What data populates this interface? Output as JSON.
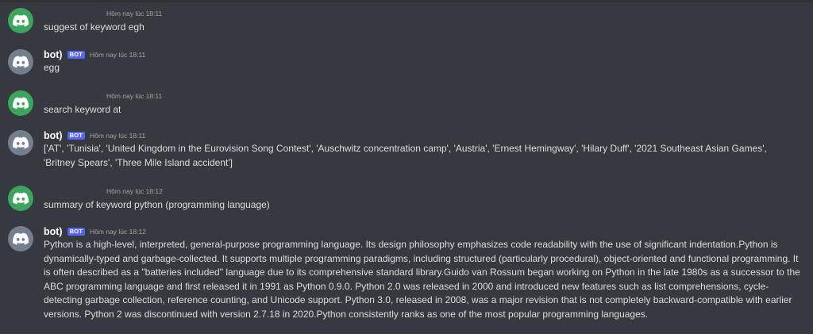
{
  "colors": {
    "background": "#36393f",
    "user_avatar": "#3ba55d",
    "bot_avatar": "#747f8d",
    "bot_badge": "#5865f2",
    "text": "#dcddde",
    "timestamp": "#a3a6aa"
  },
  "icons": {
    "avatar": "discord-logo-icon"
  },
  "messages": [
    {
      "author": "",
      "is_bot": false,
      "timestamp": "Hôm nay lúc 18:11",
      "content": "suggest of keyword egh"
    },
    {
      "author": "bot)",
      "is_bot": true,
      "badge": "BOT",
      "timestamp": "Hôm nay lúc 18:11",
      "content": "egg"
    },
    {
      "author": "",
      "is_bot": false,
      "timestamp": "Hôm nay lúc 18:11",
      "content": "search keyword at"
    },
    {
      "author": "bot)",
      "is_bot": true,
      "badge": "BOT",
      "timestamp": "Hôm nay lúc 18:11",
      "content": "['AT', 'Tunisia', 'United Kingdom in the Eurovision Song Contest', 'Auschwitz concentration camp', 'Austria', 'Ernest Hemingway', 'Hilary Duff', '2021 Southeast Asian Games', 'Britney Spears', 'Three Mile Island accident']"
    },
    {
      "author": "",
      "is_bot": false,
      "timestamp": "Hôm nay lúc 18:12",
      "content": "summary of keyword python (programming language)"
    },
    {
      "author": "bot)",
      "is_bot": true,
      "badge": "BOT",
      "timestamp": "Hôm nay lúc 18:12",
      "content": "Python is a high-level, interpreted, general-purpose programming language. Its design philosophy emphasizes code readability with the use of significant indentation.Python is dynamically-typed and garbage-collected. It supports multiple programming paradigms, including structured (particularly procedural), object-oriented and functional programming. It is often described as a \"batteries included\" language due to its comprehensive standard library.Guido van Rossum began working on Python in the late 1980s as a successor to the ABC programming language and first released it in 1991 as Python 0.9.0. Python 2.0 was released in 2000 and introduced new features such as list comprehensions, cycle-detecting garbage collection, reference counting, and Unicode support. Python 3.0, released in 2008, was a major revision that is not completely backward-compatible with earlier versions. Python 2 was discontinued with version 2.7.18 in 2020.Python consistently ranks as one of the most popular programming languages."
    }
  ]
}
